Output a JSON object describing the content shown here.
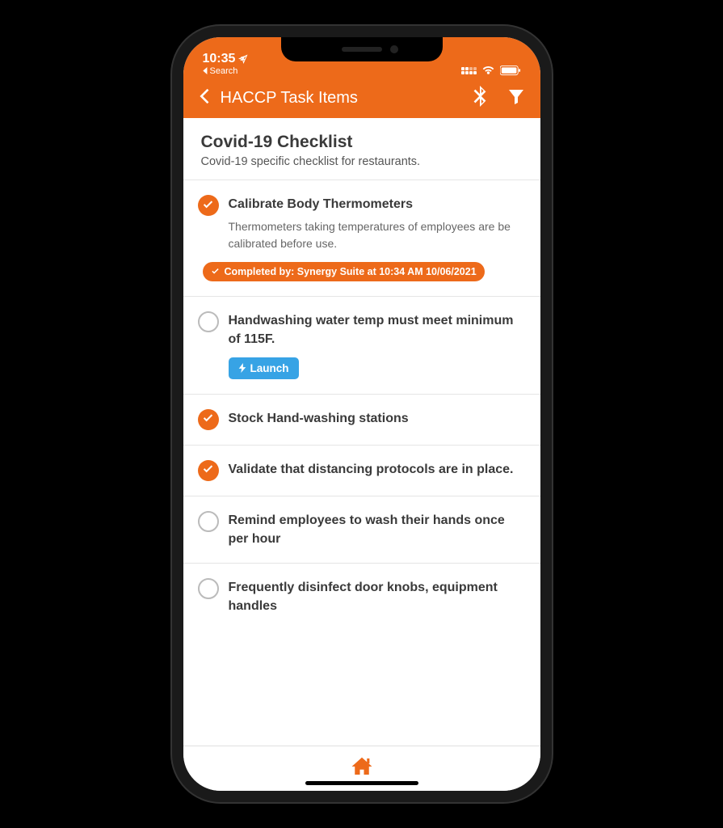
{
  "status": {
    "time": "10:35",
    "back_label": "Search"
  },
  "nav": {
    "title": "HACCP Task Items"
  },
  "page": {
    "title": "Covid-19 Checklist",
    "subtitle": "Covid-19 specific checklist for restaurants."
  },
  "tasks": [
    {
      "done": true,
      "title": "Calibrate Body Thermometers",
      "desc": "Thermometers taking temperatures of employees are be calibrated before use.",
      "completed_by": "Completed by: Synergy Suite at 10:34 AM 10/06/2021"
    },
    {
      "done": false,
      "title": "Handwashing water temp must meet minimum of 115F.",
      "launch_label": "Launch"
    },
    {
      "done": true,
      "title": "Stock Hand-washing stations"
    },
    {
      "done": true,
      "title": "Validate that distancing protocols are in place."
    },
    {
      "done": false,
      "title": "Remind employees to wash their hands once per hour"
    },
    {
      "done": false,
      "title": "Frequently disinfect door knobs, equipment handles"
    }
  ]
}
